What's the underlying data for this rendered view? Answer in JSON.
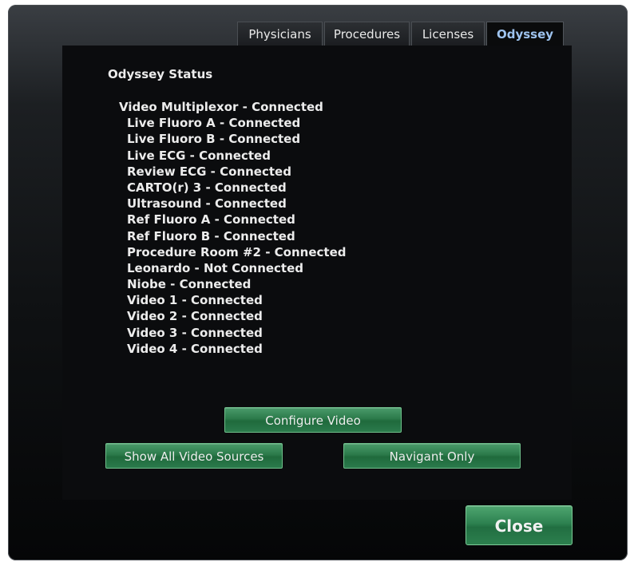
{
  "tabs": [
    {
      "label": "Physicians",
      "active": false
    },
    {
      "label": "Procedures",
      "active": false
    },
    {
      "label": "Licenses",
      "active": false
    },
    {
      "label": "Odyssey",
      "active": true
    }
  ],
  "panel": {
    "title": "Odyssey Status",
    "status_items": [
      "Video Multiplexor - Connected",
      "Live Fluoro A - Connected",
      "Live Fluoro B - Connected",
      "Live ECG - Connected",
      "Review ECG - Connected",
      "CARTO(r) 3 - Connected",
      "Ultrasound - Connected",
      "Ref Fluoro A - Connected",
      "Ref Fluoro B - Connected",
      "Procedure Room #2 - Connected",
      "Leonardo - Not Connected",
      "Niobe - Connected",
      "Video 1 - Connected",
      "Video 2 - Connected",
      "Video 3 - Connected",
      "Video 4 - Connected"
    ]
  },
  "buttons": {
    "configure_video": "Configure Video",
    "show_all_video_sources": "Show All Video Sources",
    "navigant_only": "Navigant Only",
    "close": "Close"
  },
  "colors": {
    "active_tab_text": "#9ec3ee",
    "button_green": "#2b7a4a",
    "panel_background": "#0b0c0e"
  }
}
